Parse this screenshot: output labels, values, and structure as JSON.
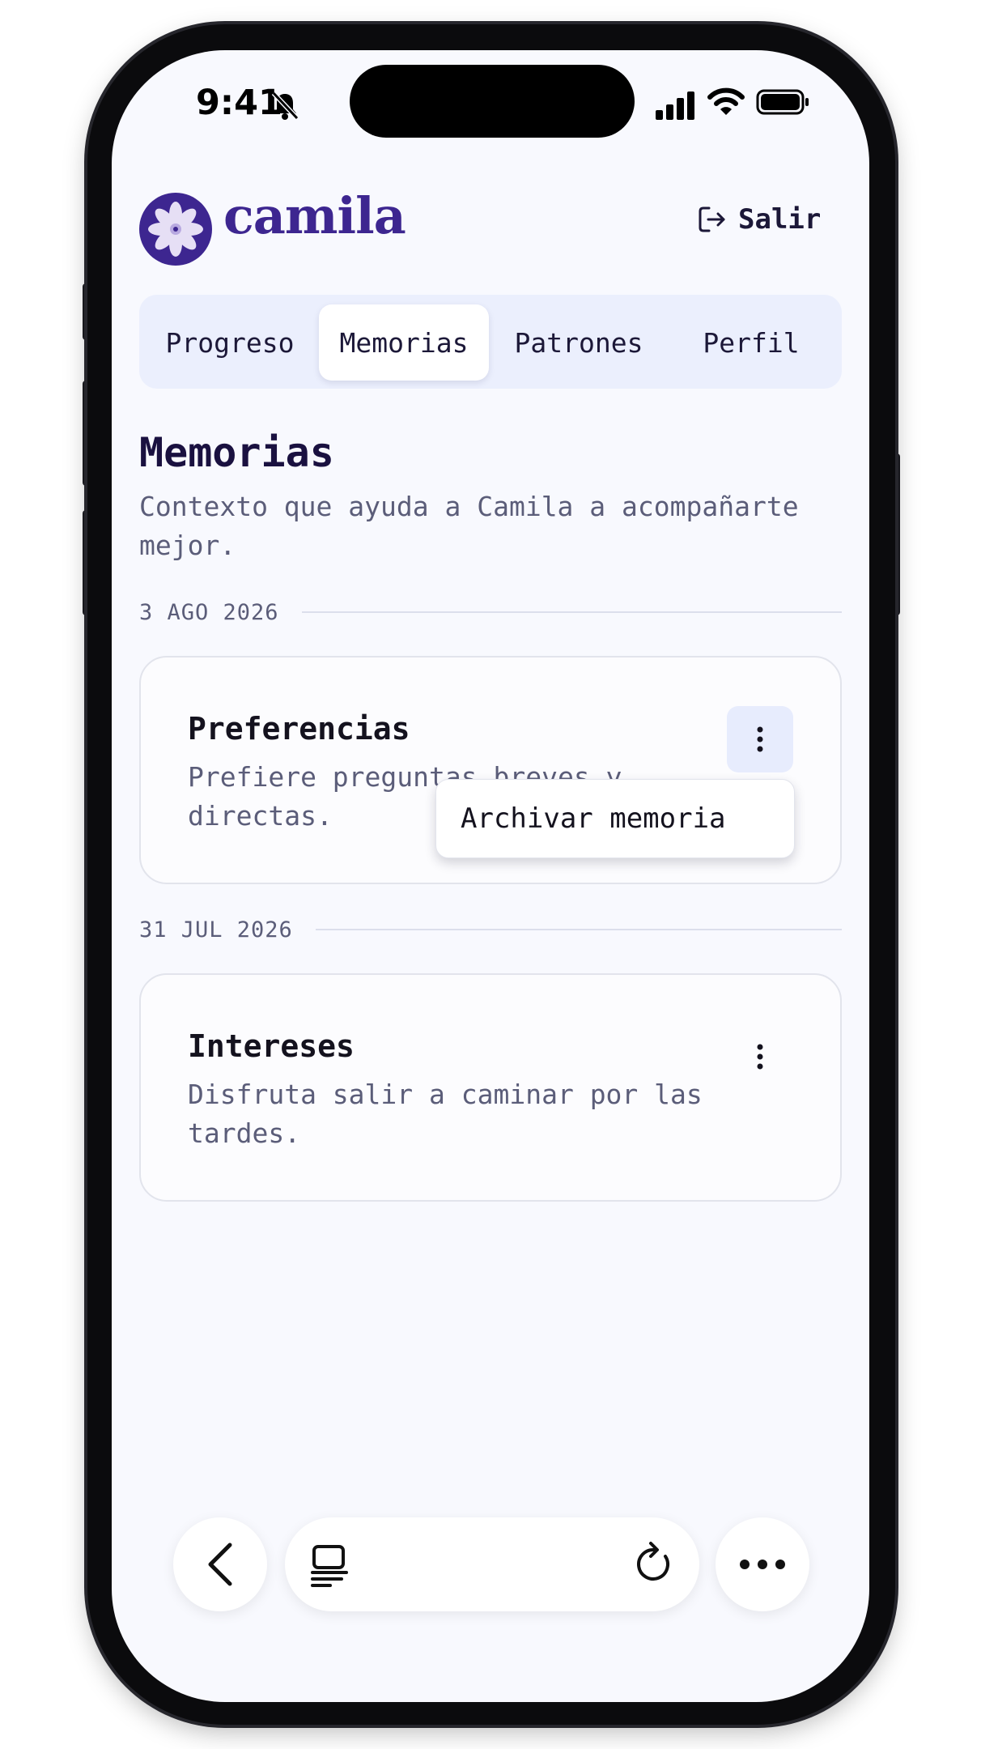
{
  "status_bar": {
    "time": "9:41"
  },
  "header": {
    "brand": "camila",
    "logout_label": "Salir"
  },
  "tabs": [
    {
      "label": "Progreso",
      "active": false
    },
    {
      "label": "Memorias",
      "active": true
    },
    {
      "label": "Patrones",
      "active": false
    },
    {
      "label": "Perfil",
      "active": false
    }
  ],
  "page": {
    "title": "Memorias",
    "subtitle": "Contexto que ayuda a Camila a acompañarte mejor."
  },
  "groups": [
    {
      "date": "3 AGO 2026",
      "memory": {
        "category": "Preferencias",
        "text": "Prefiere preguntas breves y directas.",
        "menu_open": true
      }
    },
    {
      "date": "31 JUL 2026",
      "memory": {
        "category": "Intereses",
        "text": "Disfruta salir a caminar por las tardes.",
        "menu_open": false
      }
    }
  ],
  "context_menu": {
    "item": "Archivar memoria"
  },
  "colors": {
    "brand": "#3d2690",
    "background": "#f8f9fe",
    "tab_bar": "#ebeffd",
    "muted_text": "#5b5d79"
  },
  "icons": [
    "bell-slash-icon",
    "signal-icon",
    "wifi-icon",
    "battery-icon",
    "flower-logo-icon",
    "logout-icon",
    "kebab-icon",
    "back-chevron-icon",
    "tabs-icon",
    "reload-icon",
    "more-icon"
  ]
}
